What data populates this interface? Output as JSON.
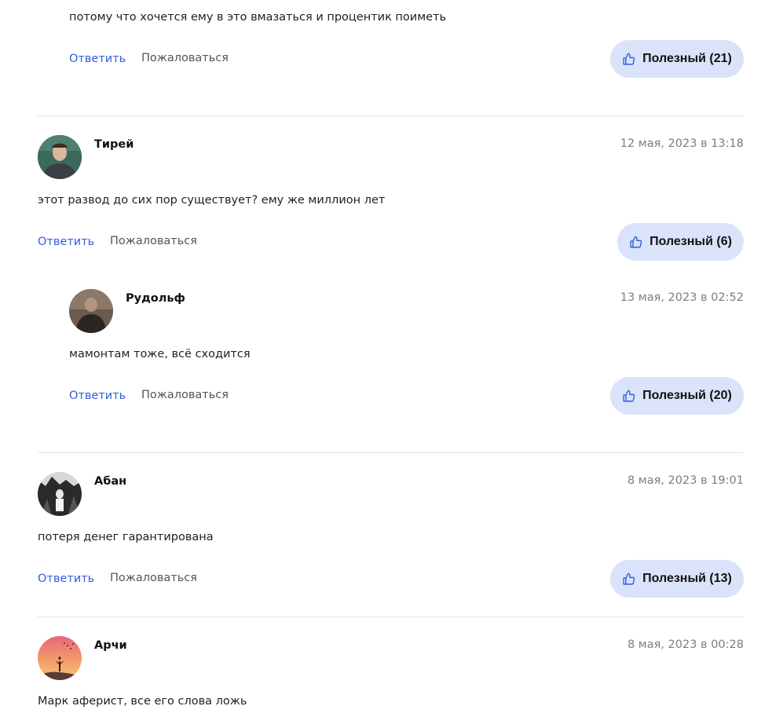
{
  "colors": {
    "accent": "#2f5fdc",
    "useful_bg": "#dbe3fb",
    "date": "#7d7d7d"
  },
  "actions": {
    "reply_label": "Ответить",
    "report_label": "Пожаловаться"
  },
  "comments": [
    {
      "text": "потому что хочется ему в это вмазаться и процентик поиметь",
      "useful_label": "Полезный (21)"
    },
    {
      "author": "Тирей",
      "date": "12 мая, 2023 в 13:18",
      "text": "этот развод до сих пор существует? ему же миллион лет",
      "useful_label": "Полезный (6)"
    },
    {
      "author": "Рудольф",
      "date": "13 мая, 2023 в 02:52",
      "text": "мамонтам тоже, всё сходится",
      "useful_label": "Полезный (20)"
    },
    {
      "author": "Абан",
      "date": "8 мая, 2023 в 19:01",
      "text": "потеря денег гарантирована",
      "useful_label": "Полезный (13)"
    },
    {
      "author": "Арчи",
      "date": "8 мая, 2023 в 00:28",
      "text": "Марк аферист, все его слова ложь"
    }
  ]
}
